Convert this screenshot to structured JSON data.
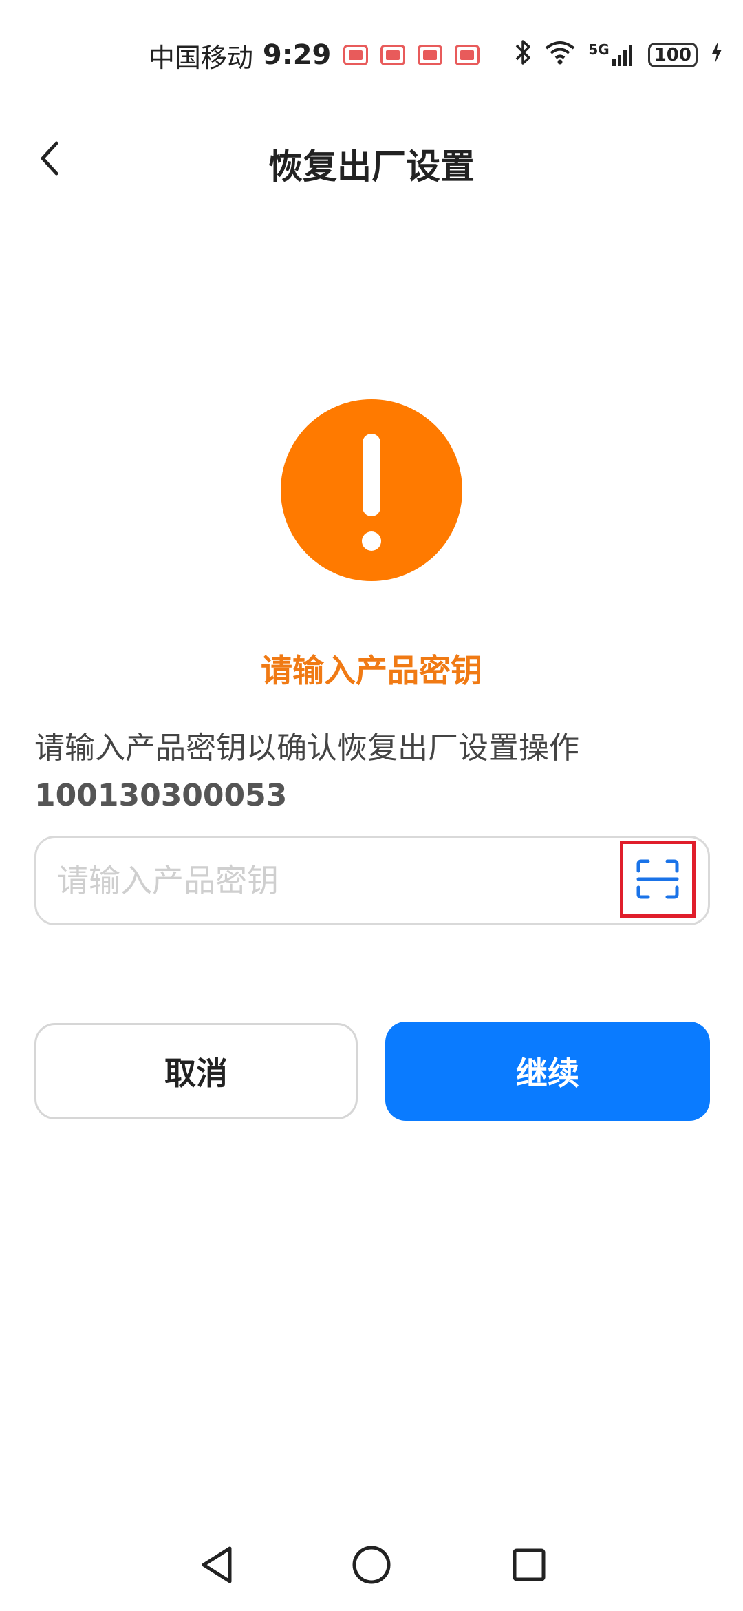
{
  "status_bar": {
    "carrier": "中国移动",
    "time": "9:29",
    "network": "5G",
    "battery": "100",
    "icons": [
      "notification-book-icon",
      "bluetooth-icon",
      "wifi-icon",
      "signal-icon",
      "battery-icon",
      "charging-icon"
    ]
  },
  "header": {
    "title": "恢复出厂设置",
    "back_icon": "chevron-left-icon"
  },
  "warning": {
    "icon": "exclamation-circle-icon",
    "title": "请输入产品密钥",
    "color": "#ff7a00"
  },
  "description": "请输入产品密钥以确认恢复出厂设置操作",
  "product_id": "100130300053",
  "key_input": {
    "placeholder": "请输入产品密钥",
    "value": "",
    "scan_icon": "scan-icon"
  },
  "buttons": {
    "cancel": "取消",
    "continue": "继续"
  },
  "colors": {
    "primary": "#0a7bff",
    "warning": "#ff7a00",
    "highlight_border": "#e01e2b"
  },
  "nav_bar": {
    "icons": [
      "triangle-back-icon",
      "circle-home-icon",
      "square-recent-icon"
    ]
  }
}
